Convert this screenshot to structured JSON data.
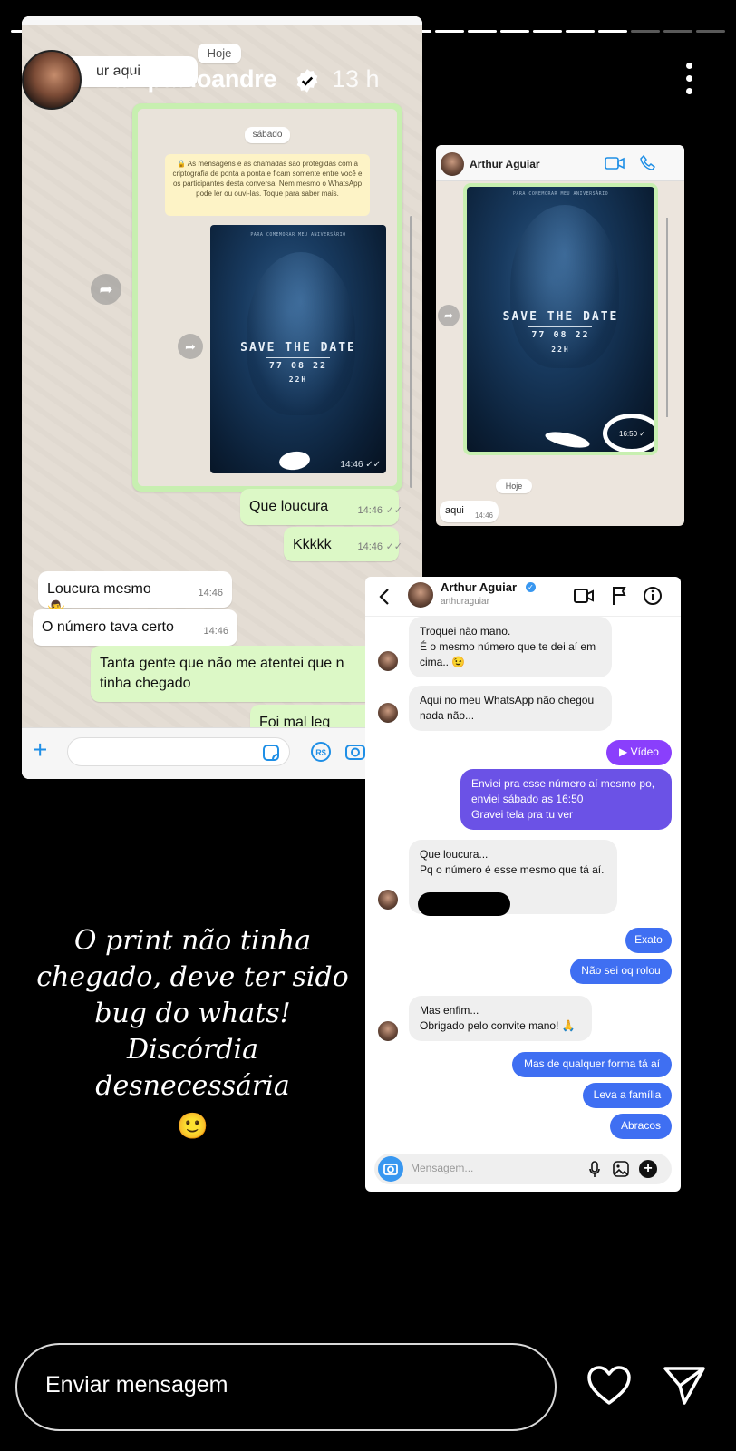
{
  "story": {
    "username": "iampauloandre",
    "time_ago": "13 h",
    "progress_segments_total": 22,
    "progress_segments_seen": 19,
    "caption_lines": [
      "O print não tinha",
      "chegado, deve ter sido",
      "bug do whats!",
      "Discórdia desnecessária"
    ],
    "caption_emoji": "🙂",
    "reply_placeholder": "Enviar mensagem"
  },
  "whatsapp_main": {
    "top_partial": "ur aqui",
    "day_label_today": "Hoje",
    "day_label_saturday": "sábado",
    "encryption_notice": "🔒 As mensagens e as chamadas são protegidas com a criptografia de ponta a ponta e ficam somente entre você e os participantes desta conversa. Nem mesmo o WhatsApp pode ler ou ouvi-las. Toque para saber mais.",
    "poster": {
      "top_text": "PARA COMEMORAR MEU ANIVERSÁRIO",
      "title": "SAVE THE DATE",
      "date": "77 08 22",
      "hour": "22H",
      "timestamp": "14:46"
    },
    "messages": [
      {
        "dir": "out",
        "text": "Que loucura",
        "time": "14:46"
      },
      {
        "dir": "out",
        "text": "Kkkkk",
        "time": "14:46"
      },
      {
        "dir": "in",
        "text": "Loucura mesmo 🤷‍♂️",
        "time": "14:46"
      },
      {
        "dir": "in",
        "text": "O número tava certo",
        "time": "14:46"
      },
      {
        "dir": "out",
        "text": "Tanta gente que não me atentei que n tinha chegado",
        "time": "14"
      },
      {
        "dir": "out",
        "text": "Foi mal leq",
        "time": "14"
      }
    ],
    "input_icons": [
      "plus-icon",
      "sticker-icon",
      "payment-icon",
      "camera-icon"
    ]
  },
  "whatsapp_small": {
    "contact_name": "Arthur Aguiar",
    "poster": {
      "top_text": "PARA COMEMORAR MEU ANIVERSÁRIO",
      "title": "SAVE THE DATE",
      "date": "77 08 22",
      "hour": "22H",
      "timestamp": "16:50"
    },
    "day_label": "Hoje",
    "message": {
      "text": "aqui",
      "time": "14:46"
    }
  },
  "instagram_dm": {
    "contact_name": "Arthur Aguiar",
    "contact_handle": "arthuraguiar",
    "messages": [
      {
        "dir": "in",
        "lines": [
          "Troquei não mano.",
          "É o mesmo número que te dei aí em",
          "cima.. 😉"
        ]
      },
      {
        "dir": "in",
        "lines": [
          "Aqui no meu WhatsApp não chegou",
          "nada não..."
        ]
      },
      {
        "dir": "out",
        "lines": [
          "▶ Vídeo"
        ]
      },
      {
        "dir": "out",
        "lines": [
          "Enviei pra esse número aí mesmo po,",
          "enviei sábado as 16:50",
          "Gravei tela pra tu ver"
        ]
      },
      {
        "dir": "in",
        "lines": [
          "Que loucura...",
          "Pq o número é esse mesmo que tá aí."
        ]
      },
      {
        "dir": "out",
        "lines": [
          "Exato"
        ]
      },
      {
        "dir": "out",
        "lines": [
          "Não sei oq rolou"
        ]
      },
      {
        "dir": "in",
        "lines": [
          "Mas enfim...",
          "Obrigado pelo convite mano! 🙏"
        ]
      },
      {
        "dir": "out",
        "lines": [
          "Mas de qualquer forma tá aí"
        ]
      },
      {
        "dir": "out",
        "lines": [
          "Leva a família"
        ]
      },
      {
        "dir": "out",
        "lines": [
          "Abracos"
        ]
      }
    ],
    "composer_placeholder": "Mensagem...",
    "colors": {
      "purple": "#8a3ffc",
      "violet": "#6b52e6",
      "blue": "#3f6ff2"
    }
  },
  "colors": {
    "wa_out": "#dcf8c6",
    "wa_in": "#ffffff",
    "wa_background": "#ece5dd",
    "ig_in": "#efefef",
    "story_bg": "#000000"
  }
}
